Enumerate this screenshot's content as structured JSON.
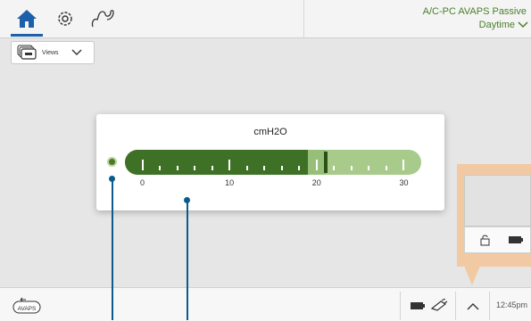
{
  "header": {
    "mode_title": "A/C-PC AVAPS Passive",
    "mode_subtitle": "Daytime",
    "colors": {
      "accent": "#1d5fa8",
      "mode_text": "#4b7f2a"
    },
    "icons": [
      "home-icon",
      "settings-gear-icon",
      "circuit-icon",
      "chevron-down-icon"
    ]
  },
  "views": {
    "label": "Views"
  },
  "gauge": {
    "unit": "cmH2O",
    "min": -2,
    "max": 32,
    "value": 19,
    "upper_value": 21,
    "tick_labels": [
      "0",
      "10",
      "20",
      "30"
    ],
    "colors": {
      "fill": "#3e7025",
      "track": "#a8cb8c",
      "marker": "#2b5214"
    }
  },
  "bottom": {
    "avaps_label": "AVAPS",
    "time": "12:45pm",
    "icons": [
      "battery-icon",
      "power-plug-icon",
      "chevron-up-icon",
      "lock-icon"
    ]
  },
  "callout": {
    "color": "#f1c9a3"
  }
}
